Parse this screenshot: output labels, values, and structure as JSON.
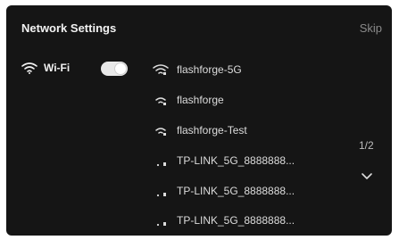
{
  "header": {
    "title": "Network Settings",
    "skip_label": "Skip"
  },
  "wifi": {
    "label": "Wi-Fi",
    "enabled": true
  },
  "networks": [
    {
      "name": "flashforge-5G",
      "icon": "wifi-icon"
    },
    {
      "name": "flashforge",
      "icon": "wifi-icon"
    },
    {
      "name": "flashforge-Test",
      "icon": "wifi-icon"
    },
    {
      "name": "TP-LINK_5G_8888888...",
      "icon": "weak-signal-icon"
    },
    {
      "name": "TP-LINK_5G_8888888...",
      "icon": "weak-signal-icon"
    },
    {
      "name": "TP-LINK_5G_8888888...",
      "icon": "weak-signal-icon"
    }
  ],
  "pagination": {
    "page_text": "1/2"
  },
  "colors": {
    "background": "#151515",
    "text": "#e6e6e6",
    "muted": "#8a8a8a",
    "toggle_on": "#e9e9e9"
  }
}
